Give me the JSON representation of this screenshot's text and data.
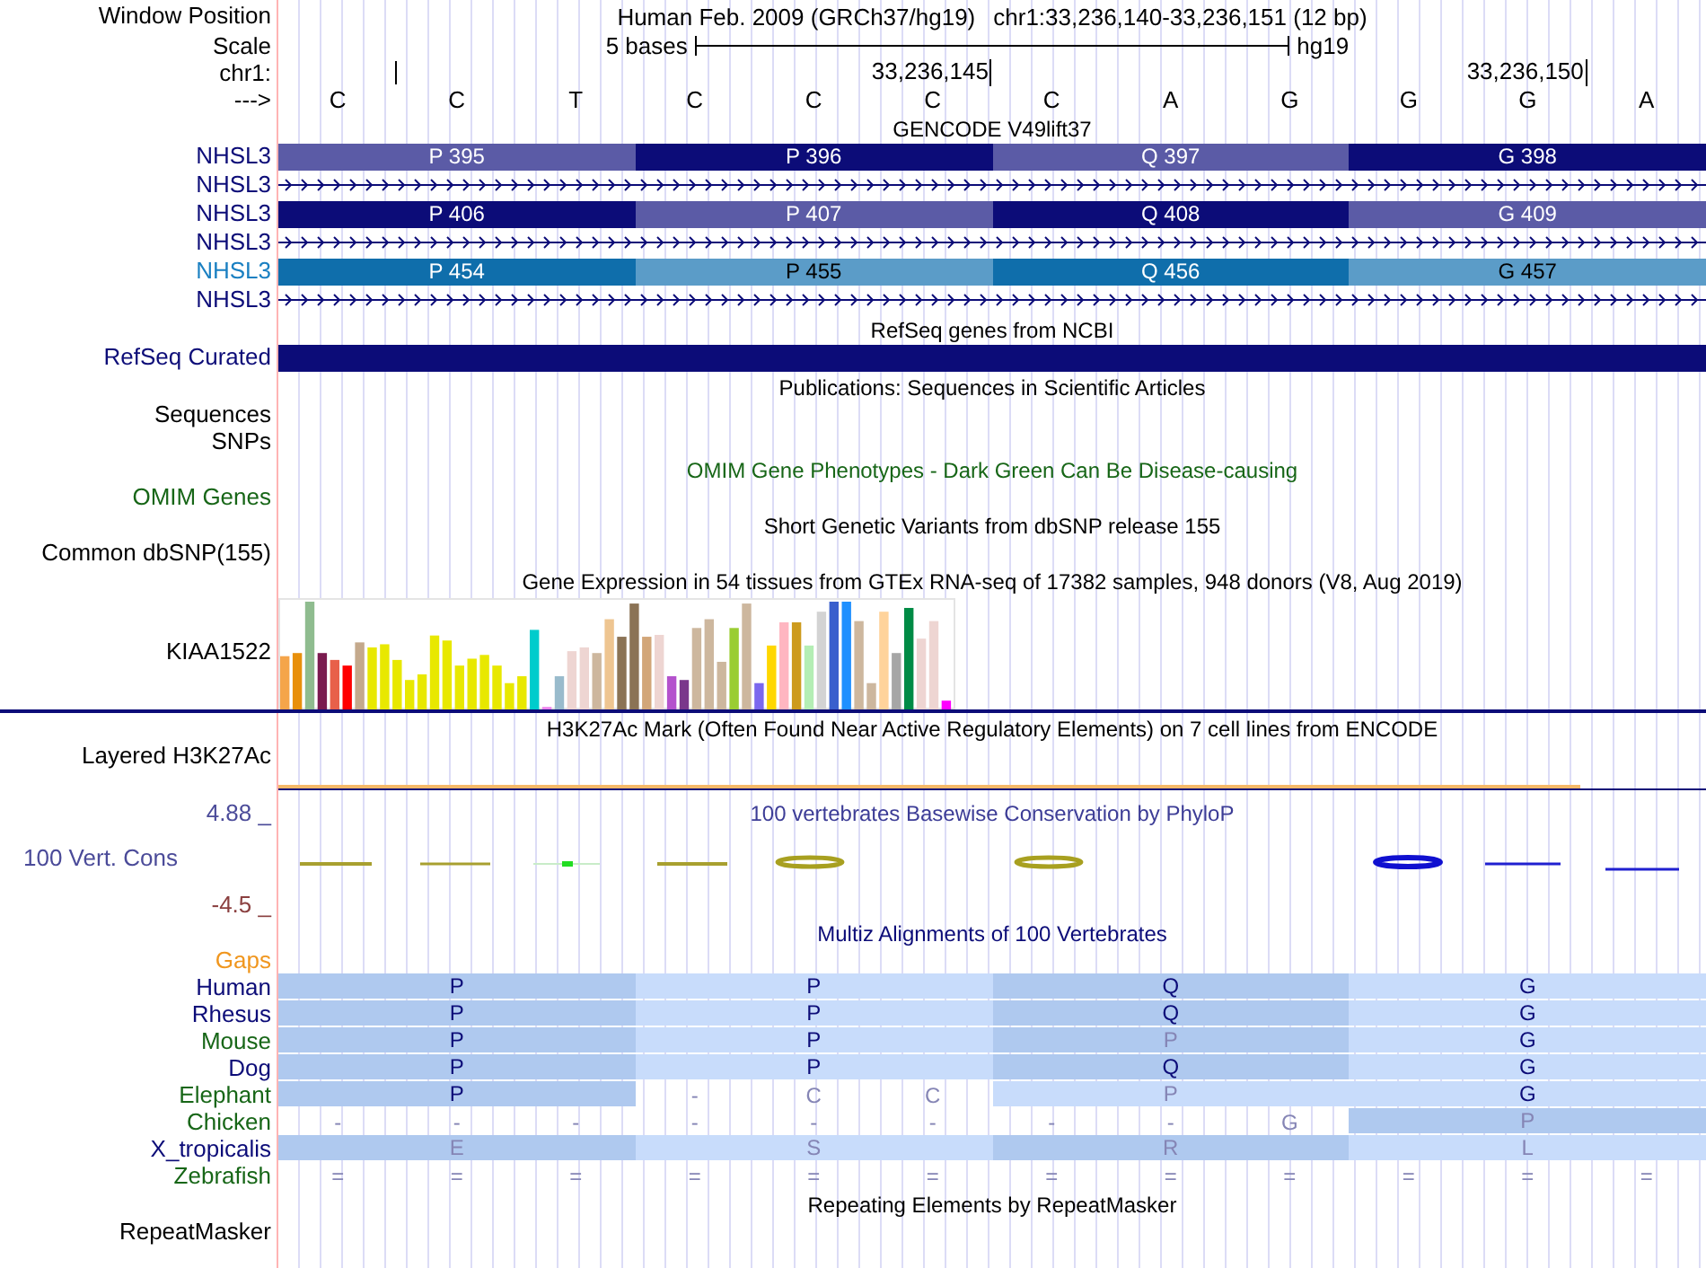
{
  "header": {
    "position_label": "Window Position",
    "position": "Human Feb. 2009 (GRCh37/hg19)",
    "range": "chr1:33,236,140-33,236,151 (12 bp)",
    "scale_label": "Scale",
    "scale": "5 bases",
    "assembly": "hg19",
    "chrom_label": "chr1:",
    "ticks": [
      "33,236,145",
      "33,236,150"
    ],
    "strand_label": "--->",
    "bases": [
      "C",
      "C",
      "T",
      "C",
      "C",
      "C",
      "C",
      "A",
      "G",
      "G",
      "G",
      "A"
    ]
  },
  "tracks": [
    {
      "title": {
        "text": "GENCODE V49lift37"
      },
      "rows": [
        {
          "kind": "codons",
          "label": "NHSL3",
          "color": "#0c0c78",
          "segments": [
            {
              "text": "P 395",
              "color": "#5b5ba6"
            },
            {
              "text": "P 396",
              "color": "#0c0c78"
            },
            {
              "text": "Q 397",
              "color": "#5b5ba6"
            },
            {
              "text": "G 398",
              "color": "#0c0c78"
            }
          ]
        },
        {
          "kind": "intron",
          "label": "NHSL3",
          "color": "#0c0c78"
        },
        {
          "kind": "codons",
          "label": "NHSL3",
          "color": "#0c0c78",
          "segments": [
            {
              "text": "P 406",
              "color": "#0c0c78"
            },
            {
              "text": "P 407",
              "color": "#5b5ba6"
            },
            {
              "text": "Q 408",
              "color": "#0c0c78"
            },
            {
              "text": "G 409",
              "color": "#5b5ba6"
            }
          ]
        },
        {
          "kind": "intron",
          "label": "NHSL3",
          "color": "#0c0c78"
        },
        {
          "kind": "codons",
          "label": "NHSL3",
          "color": "#1b80c2",
          "segments": [
            {
              "text": "P 454",
              "color": "#0f6eab"
            },
            {
              "text": "P 455",
              "color": "#5b9cc8"
            },
            {
              "text": "Q 456",
              "color": "#0f6eab"
            },
            {
              "text": "G 457",
              "color": "#5b9cc8"
            }
          ]
        },
        {
          "kind": "intron",
          "label": "NHSL3",
          "color": "#0c0c78"
        }
      ]
    },
    {
      "title": {
        "text": "RefSeq genes from NCBI"
      },
      "rows": [
        {
          "kind": "bar",
          "label": "RefSeq Curated",
          "color": "#0c0c78"
        }
      ]
    },
    {
      "title": {
        "text": "Publications: Sequences in Scientific Articles"
      },
      "rows": [
        {
          "kind": "empty",
          "label": "Sequences"
        },
        {
          "kind": "empty",
          "label": "SNPs"
        }
      ]
    },
    {
      "title": {
        "text": "OMIM Gene Phenotypes - Dark Green Can Be Disease-causing",
        "color": "#176617"
      },
      "rows": [
        {
          "kind": "empty",
          "label": "OMIM Genes",
          "color": "#176617"
        }
      ]
    },
    {
      "title": {
        "text": "Short Genetic Variants from dbSNP release 155"
      },
      "rows": [
        {
          "kind": "empty",
          "label": "Common dbSNP(155)"
        }
      ]
    },
    {
      "title": {
        "text": "Gene Expression in 54 tissues from GTEx RNA-seq of 17382 samples, 948 donors (V8, Aug 2019)"
      },
      "rows": [
        {
          "kind": "expression",
          "label": "KIAA1522"
        }
      ]
    },
    {
      "title": {
        "text": "H3K27Ac Mark (Often Found Near Active Regulatory Elements) on 7 cell lines from ENCODE"
      },
      "rows": [
        {
          "kind": "empty",
          "label": "Layered H3K27Ac"
        },
        {
          "kind": "signal"
        }
      ]
    },
    {
      "title": {
        "text": "100 vertebrates Basewise Conservation by PhyloP",
        "color": "#3c3c96"
      },
      "upper_limit": "4.88 _",
      "lower_limit": "-4.5 _",
      "rows": [
        {
          "kind": "wiggle",
          "label": "100 Vert. Cons",
          "color": "#4b4b99"
        }
      ]
    },
    {
      "title": {
        "text": "Multiz Alignments of 100 Vertebrates",
        "color": "#0c0c78"
      },
      "rows": [
        {
          "kind": "empty",
          "label": "Gaps",
          "color": "#f0961e"
        },
        {
          "kind": "species",
          "label": "Human",
          "color": "#0c0c78",
          "cells": [
            {
              "kind": "codon",
              "text": "P",
              "color": "#afc9ef",
              "match": true
            },
            {
              "kind": "codon",
              "text": "P",
              "color": "#c8dcfb",
              "match": true
            },
            {
              "kind": "codon",
              "text": "Q",
              "color": "#afc9ef",
              "match": true
            },
            {
              "kind": "codon",
              "text": "G",
              "color": "#c8dcfb",
              "match": true
            }
          ]
        },
        {
          "kind": "species",
          "label": "Rhesus",
          "color": "#0c0c78",
          "cells": [
            {
              "kind": "codon",
              "text": "P",
              "color": "#afc9ef",
              "match": true
            },
            {
              "kind": "codon",
              "text": "P",
              "color": "#c8dcfb",
              "match": true
            },
            {
              "kind": "codon",
              "text": "Q",
              "color": "#afc9ef",
              "match": true
            },
            {
              "kind": "codon",
              "text": "G",
              "color": "#c8dcfb",
              "match": true
            }
          ]
        },
        {
          "kind": "species",
          "label": "Mouse",
          "color": "#176617",
          "cells": [
            {
              "kind": "codon",
              "text": "P",
              "color": "#afc9ef",
              "match": true
            },
            {
              "kind": "codon",
              "text": "P",
              "color": "#c8dcfb",
              "match": true
            },
            {
              "kind": "codon",
              "text": "P",
              "color": "#afc9ef",
              "match": false
            },
            {
              "kind": "codon",
              "text": "G",
              "color": "#c8dcfb",
              "match": true
            }
          ]
        },
        {
          "kind": "species",
          "label": "Dog",
          "color": "#0c0c78",
          "cells": [
            {
              "kind": "codon",
              "text": "P",
              "color": "#afc9ef",
              "match": true
            },
            {
              "kind": "codon",
              "text": "P",
              "color": "#c8dcfb",
              "match": true
            },
            {
              "kind": "codon",
              "text": "Q",
              "color": "#afc9ef",
              "match": true
            },
            {
              "kind": "codon",
              "text": "G",
              "color": "#c8dcfb",
              "match": true
            }
          ]
        },
        {
          "kind": "species",
          "label": "Elephant",
          "color": "#176617",
          "cells": [
            {
              "kind": "codon",
              "text": "P",
              "color": "#afc9ef",
              "match": true
            },
            {
              "kind": "base",
              "text": "-"
            },
            {
              "kind": "base",
              "text": "C"
            },
            {
              "kind": "base",
              "text": "C"
            },
            {
              "kind": "codon",
              "text": "P",
              "color": "#c8dcfb",
              "match": false
            },
            {
              "kind": "codon",
              "text": "G",
              "color": "#c8dcfb",
              "match": true
            }
          ]
        },
        {
          "kind": "species",
          "label": "Chicken",
          "color": "#176617",
          "cells": [
            {
              "kind": "base",
              "text": "-"
            },
            {
              "kind": "base",
              "text": "-"
            },
            {
              "kind": "base",
              "text": "-"
            },
            {
              "kind": "base",
              "text": "-"
            },
            {
              "kind": "base",
              "text": "-"
            },
            {
              "kind": "base",
              "text": "-"
            },
            {
              "kind": "base",
              "text": "-"
            },
            {
              "kind": "base",
              "text": "-"
            },
            {
              "kind": "base",
              "text": "G"
            },
            {
              "kind": "codon",
              "text": "P",
              "color": "#afc9ef",
              "match": false
            }
          ]
        },
        {
          "kind": "species",
          "label": "X_tropicalis",
          "color": "#0c0c78",
          "cells": [
            {
              "kind": "codon",
              "text": "E",
              "color": "#afc9ef",
              "match": false
            },
            {
              "kind": "codon",
              "text": "S",
              "color": "#c8dcfb",
              "match": false
            },
            {
              "kind": "codon",
              "text": "R",
              "color": "#afc9ef",
              "match": false
            },
            {
              "kind": "codon",
              "text": "L",
              "color": "#c8dcfb",
              "match": false
            }
          ]
        },
        {
          "kind": "species",
          "label": "Zebrafish",
          "color": "#176617",
          "cells": [
            {
              "kind": "base",
              "text": "="
            },
            {
              "kind": "base",
              "text": "="
            },
            {
              "kind": "base",
              "text": "="
            },
            {
              "kind": "base",
              "text": "="
            },
            {
              "kind": "base",
              "text": "="
            },
            {
              "kind": "base",
              "text": "="
            },
            {
              "kind": "base",
              "text": "="
            },
            {
              "kind": "base",
              "text": "="
            },
            {
              "kind": "base",
              "text": "="
            },
            {
              "kind": "base",
              "text": "="
            },
            {
              "kind": "base",
              "text": "="
            },
            {
              "kind": "base",
              "text": "="
            }
          ]
        }
      ]
    },
    {
      "title": {
        "text": "Repeating Elements by RepeatMasker"
      },
      "rows": [
        {
          "kind": "empty",
          "label": "RepeatMasker"
        }
      ]
    }
  ]
}
